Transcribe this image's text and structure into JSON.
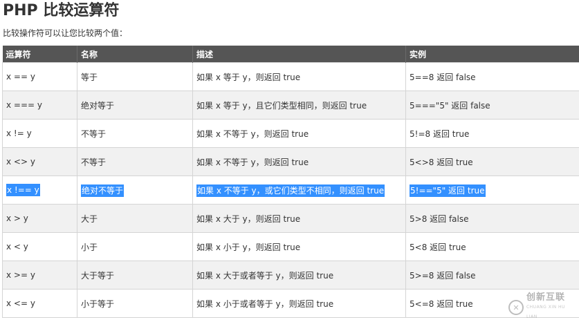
{
  "page": {
    "title": "PHP 比较运算符",
    "intro": "比较操作符可以让您比较两个值："
  },
  "table": {
    "headers": [
      "运算符",
      "名称",
      "描述",
      "实例"
    ],
    "rows": [
      [
        "x == y",
        "等于",
        "如果 x 等于 y，则返回 true",
        "5==8 返回 false"
      ],
      [
        "x === y",
        "绝对等于",
        "如果 x 等于 y，且它们类型相同，则返回 true",
        "5===\"5\" 返回 false"
      ],
      [
        "x != y",
        "不等于",
        "如果 x 不等于 y，则返回 true",
        "5!=8 返回 true"
      ],
      [
        "x <> y",
        "不等于",
        "如果 x 不等于 y，则返回 true",
        "5<>8 返回 true"
      ],
      [
        "x !== y",
        "绝对不等于",
        "如果 x 不等于 y，或它们类型不相同，则返回 true",
        "5!==\"5\" 返回 true"
      ],
      [
        "x > y",
        "大于",
        "如果 x 大于 y，则返回 true",
        "5>8 返回 false"
      ],
      [
        "x < y",
        "小于",
        "如果 x 小于 y，则返回 true",
        "5<8 返回 true"
      ],
      [
        "x >= y",
        "大于等于",
        "如果 x 大于或者等于 y，则返回 true",
        "5>=8 返回 false"
      ],
      [
        "x <= y",
        "小于等于",
        "如果 x 小于或者等于 y，则返回 true",
        "5<=8 返回 true"
      ]
    ]
  },
  "watermark": {
    "logo_icon": "chuangxin-logo-icon",
    "name": "创新互联",
    "subtitle": "CHUANG XIN HU LIAN"
  },
  "colors": {
    "header_bg": "#555555",
    "selection": "#3390ff",
    "row_alt": "#f1f1f1"
  }
}
